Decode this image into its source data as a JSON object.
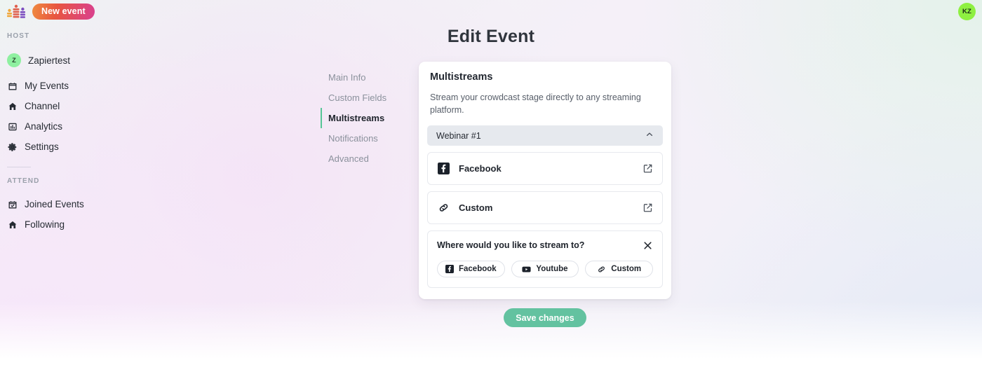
{
  "topbar": {
    "logo_icon": "crowdcast-bars-logo",
    "new_event_label": "New event",
    "avatar_initials": "KZ",
    "avatar_color": "#8ef041"
  },
  "sidebar": {
    "host_label": "HOST",
    "attend_label": "ATTEND",
    "org": {
      "initial": "Z",
      "name": "Zapiertest"
    },
    "host_items": [
      {
        "label": "My Events",
        "icon": "calendar-icon"
      },
      {
        "label": "Channel",
        "icon": "home-icon"
      },
      {
        "label": "Analytics",
        "icon": "chart-icon"
      },
      {
        "label": "Settings",
        "icon": "gear-icon"
      }
    ],
    "attend_items": [
      {
        "label": "Joined Events",
        "icon": "calendar-check-icon"
      },
      {
        "label": "Following",
        "icon": "home-icon"
      }
    ]
  },
  "header": {
    "title": "Edit Event"
  },
  "section_nav": {
    "items": [
      {
        "label": "Main Info",
        "active": false
      },
      {
        "label": "Custom Fields",
        "active": false
      },
      {
        "label": "Multistreams",
        "active": true
      },
      {
        "label": "Notifications",
        "active": false
      },
      {
        "label": "Advanced",
        "active": false
      }
    ],
    "active_accent": "#56c596"
  },
  "card": {
    "title": "Multistreams",
    "description": "Stream your crowdcast stage directly to any streaming platform.",
    "accordion": {
      "label": "Webinar #1",
      "chevron": "chevron-up-icon",
      "expanded": true
    },
    "destinations": [
      {
        "label": "Facebook",
        "icon": "facebook-icon",
        "action_icon": "edit-square-icon"
      },
      {
        "label": "Custom",
        "icon": "link-chain-icon",
        "action_icon": "edit-square-icon"
      }
    ],
    "picker": {
      "title": "Where would you like to stream to?",
      "close_icon": "close-icon",
      "options": [
        {
          "label": "Facebook",
          "icon": "facebook-icon"
        },
        {
          "label": "Youtube",
          "icon": "youtube-icon"
        },
        {
          "label": "Custom",
          "icon": "link-chain-icon"
        }
      ]
    }
  },
  "footer": {
    "save_label": "Save changes",
    "save_color": "#63c2a0"
  }
}
